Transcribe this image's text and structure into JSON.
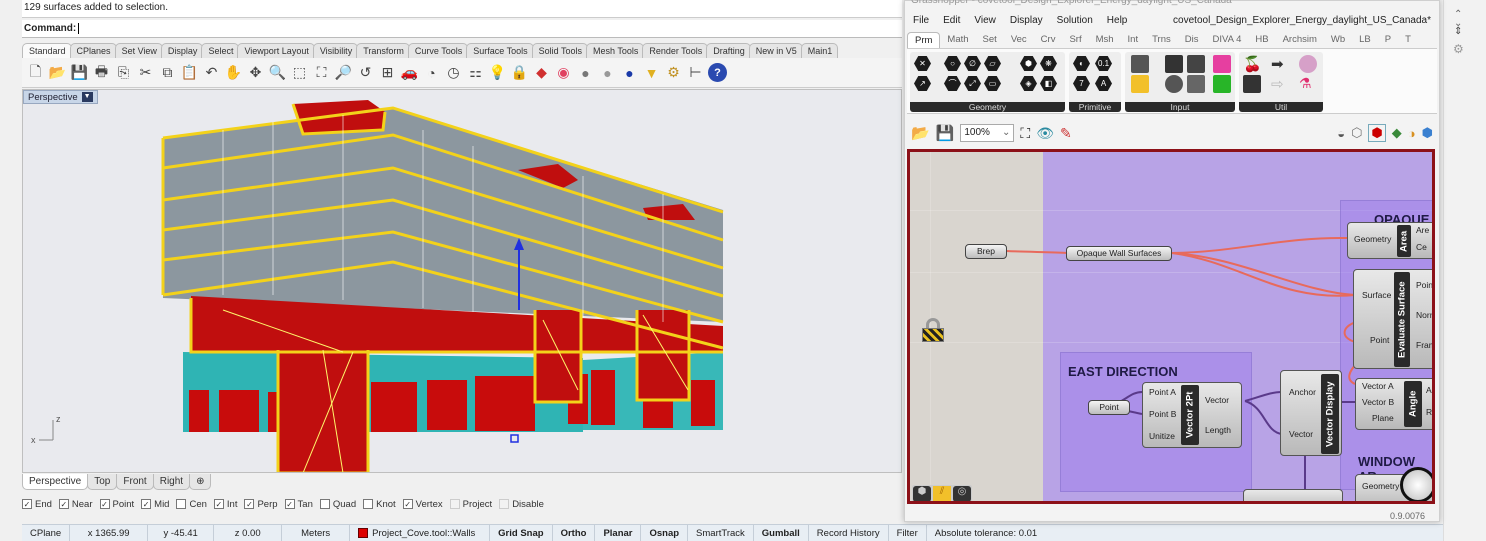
{
  "rhino": {
    "history_line": "129 surfaces added to selection.",
    "command_label": "Command:",
    "toolbar_tabs": [
      "Standard",
      "CPlanes",
      "Set View",
      "Display",
      "Select",
      "Viewport Layout",
      "Visibility",
      "Transform",
      "Curve Tools",
      "Surface Tools",
      "Solid Tools",
      "Mesh Tools",
      "Render Tools",
      "Drafting",
      "New in V5",
      "Main1"
    ],
    "toolbar_icons": [
      {
        "name": "new-icon",
        "glyph": "🗋"
      },
      {
        "name": "open-icon",
        "glyph": "📂"
      },
      {
        "name": "save-icon",
        "glyph": "💾"
      },
      {
        "name": "print-icon",
        "glyph": "🖶"
      },
      {
        "name": "import-icon",
        "glyph": "⎘"
      },
      {
        "name": "cut-icon",
        "glyph": "✂"
      },
      {
        "name": "copy-icon",
        "glyph": "⧉"
      },
      {
        "name": "paste-icon",
        "glyph": "📋"
      },
      {
        "name": "undo-icon",
        "glyph": "↶"
      },
      {
        "name": "pan-icon",
        "glyph": "✋"
      },
      {
        "name": "rotate-view-icon",
        "glyph": "✥"
      },
      {
        "name": "zoom-icon",
        "glyph": "🔍"
      },
      {
        "name": "zoom-window-icon",
        "glyph": "⬚"
      },
      {
        "name": "zoom-extents-icon",
        "glyph": "⛶"
      },
      {
        "name": "zoom-selected-icon",
        "glyph": "🔎"
      },
      {
        "name": "undo-view-icon",
        "glyph": "↺"
      },
      {
        "name": "four-viewports-icon",
        "glyph": "⊞"
      },
      {
        "name": "car-icon",
        "glyph": "🚗"
      },
      {
        "name": "osnap-icon",
        "glyph": "◔"
      },
      {
        "name": "clock-icon",
        "glyph": "◷"
      },
      {
        "name": "layer-icon",
        "glyph": "⚏"
      },
      {
        "name": "light-icon",
        "glyph": "💡"
      },
      {
        "name": "lock-icon",
        "glyph": "🔒"
      },
      {
        "name": "properties-icon",
        "glyph": "◆"
      },
      {
        "name": "color-wheel-icon",
        "glyph": "◉"
      },
      {
        "name": "shaded-sphere-icon",
        "glyph": "●"
      },
      {
        "name": "rendered-sphere-icon",
        "glyph": "●"
      },
      {
        "name": "blue-sphere-icon",
        "glyph": "●"
      },
      {
        "name": "cone-icon",
        "glyph": "▼"
      },
      {
        "name": "gear-icon",
        "glyph": "⚙"
      },
      {
        "name": "dimension-icon",
        "glyph": "⊢"
      },
      {
        "name": "help-icon",
        "glyph": "?"
      }
    ],
    "viewport_title": "Perspective",
    "viewport_tabs": [
      "Perspective",
      "Top",
      "Front",
      "Right"
    ],
    "osnaps": [
      {
        "label": "End",
        "checked": true
      },
      {
        "label": "Near",
        "checked": true
      },
      {
        "label": "Point",
        "checked": true
      },
      {
        "label": "Mid",
        "checked": true
      },
      {
        "label": "Cen",
        "checked": false
      },
      {
        "label": "Int",
        "checked": true
      },
      {
        "label": "Perp",
        "checked": true
      },
      {
        "label": "Tan",
        "checked": true
      },
      {
        "label": "Quad",
        "checked": false
      },
      {
        "label": "Knot",
        "checked": false
      },
      {
        "label": "Vertex",
        "checked": true
      },
      {
        "label": "Project",
        "checked": false,
        "disabled": true
      },
      {
        "label": "Disable",
        "checked": false,
        "disabled": true
      }
    ],
    "status": {
      "cplane": "CPlane",
      "x": "x 1365.99",
      "y": "y -45.41",
      "z": "z 0.00",
      "units": "Meters",
      "layer": "Project_Cove.tool::Walls",
      "layer_color": "#dd0000",
      "grid_snap": "Grid Snap",
      "ortho": "Ortho",
      "planar": "Planar",
      "osnap": "Osnap",
      "smarttrack": "SmartTrack",
      "gumball": "Gumball",
      "record_history": "Record History",
      "filter": "Filter",
      "tolerance": "Absolute tolerance: 0.01"
    },
    "axis_labels": {
      "x": "x",
      "z": "z"
    }
  },
  "grasshopper": {
    "window_title": "Grasshopper - covetool_Design_Explorer_Energy_daylight_US_Canada",
    "menu": [
      "File",
      "Edit",
      "View",
      "Display",
      "Solution",
      "Help"
    ],
    "document_name": "covetool_Design_Explorer_Energy_daylight_US_Canada*",
    "component_tabs": [
      "Prm",
      "Math",
      "Set",
      "Vec",
      "Crv",
      "Srf",
      "Msh",
      "Int",
      "Trns",
      "Dis",
      "DIVA 4",
      "HB",
      "Archsim",
      "Wb",
      "LB",
      "P",
      "T"
    ],
    "ribbon_groups": [
      "Geometry",
      "Primitive",
      "Input",
      "Util"
    ],
    "primitive_glyphs": [
      "0.1",
      "7",
      "A"
    ],
    "zoom_level": "100%",
    "version": "0.9.0076",
    "canvas": {
      "nodes": {
        "brep": "Brep",
        "opaque_wall": "Opaque Wall Surfaces",
        "point": "Point",
        "area": {
          "title": "Area",
          "inputs": [
            "Geometry"
          ],
          "outputs": [
            "Are",
            "Ce"
          ]
        },
        "evaluate": {
          "title": "Evaluate Surface",
          "inputs": [
            "Surface",
            "Point"
          ],
          "outputs": [
            "Poin",
            "Norm",
            "Fram"
          ]
        },
        "vector2pt": {
          "title": "Vector 2Pt",
          "inputs": [
            "Point A",
            "Point B",
            "Unitize"
          ],
          "outputs": [
            "Vector",
            "Length"
          ]
        },
        "vector_display": {
          "title": "Vector Display",
          "inputs": [
            "Anchor",
            "Vector"
          ]
        },
        "angle": {
          "title": "Angle",
          "inputs": [
            "Vector A",
            "Vector B",
            "Plane"
          ],
          "outputs": [
            "An",
            "Re"
          ]
        },
        "window_geometry": {
          "inputs": [
            "Geometry"
          ]
        }
      },
      "groups": {
        "east": "EAST DIRECTION",
        "opaque": "OPAQUE",
        "window": "WINDOW AR"
      }
    }
  }
}
